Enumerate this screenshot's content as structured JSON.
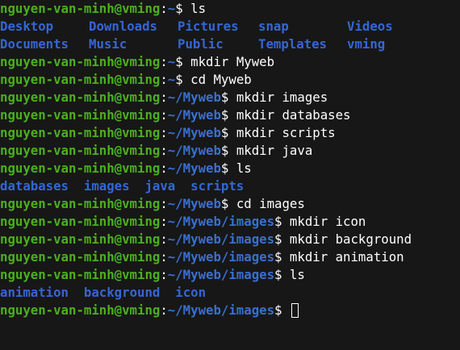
{
  "prompt": {
    "user_host": "nguyen-van-minh@vming",
    "colon": ":",
    "dollar": "$"
  },
  "lines": [
    {
      "type": "prompt",
      "path": "~",
      "command": " ls"
    },
    {
      "type": "listing",
      "items": [
        "Desktop",
        "Downloads",
        "Pictures",
        "snap",
        "Videos"
      ]
    },
    {
      "type": "listing",
      "items": [
        "Documents",
        "Music",
        "Public",
        "Templates",
        "vming"
      ]
    },
    {
      "type": "prompt",
      "path": "~",
      "command": " mkdir Myweb"
    },
    {
      "type": "prompt",
      "path": "~",
      "command": " cd Myweb"
    },
    {
      "type": "prompt",
      "path": "~/Myweb",
      "command": " mkdir images"
    },
    {
      "type": "prompt",
      "path": "~/Myweb",
      "command": " mkdir databases"
    },
    {
      "type": "prompt",
      "path": "~/Myweb",
      "command": " mkdir scripts"
    },
    {
      "type": "prompt",
      "path": "~/Myweb",
      "command": " mkdir java"
    },
    {
      "type": "prompt",
      "path": "~/Myweb",
      "command": " ls"
    },
    {
      "type": "listing_inline",
      "items": [
        "databases",
        "images",
        "java",
        "scripts"
      ]
    },
    {
      "type": "prompt",
      "path": "~/Myweb",
      "command": " cd images"
    },
    {
      "type": "prompt",
      "path": "~/Myweb/images",
      "command": " mkdir icon"
    },
    {
      "type": "prompt",
      "path": "~/Myweb/images",
      "command": " mkdir background"
    },
    {
      "type": "prompt",
      "path": "~/Myweb/images",
      "command": " mkdir animation"
    },
    {
      "type": "prompt",
      "path": "~/Myweb/images",
      "command": " ls"
    },
    {
      "type": "listing_inline",
      "items": [
        "animation",
        "background",
        "icon"
      ]
    },
    {
      "type": "prompt",
      "path": "~/Myweb/images",
      "command": " ",
      "cursor": true
    }
  ],
  "colors": {
    "background": "#171717",
    "user": "#4caf1f",
    "path": "#3a6fd0",
    "directory": "#3566d6",
    "text": "#ffffff"
  }
}
